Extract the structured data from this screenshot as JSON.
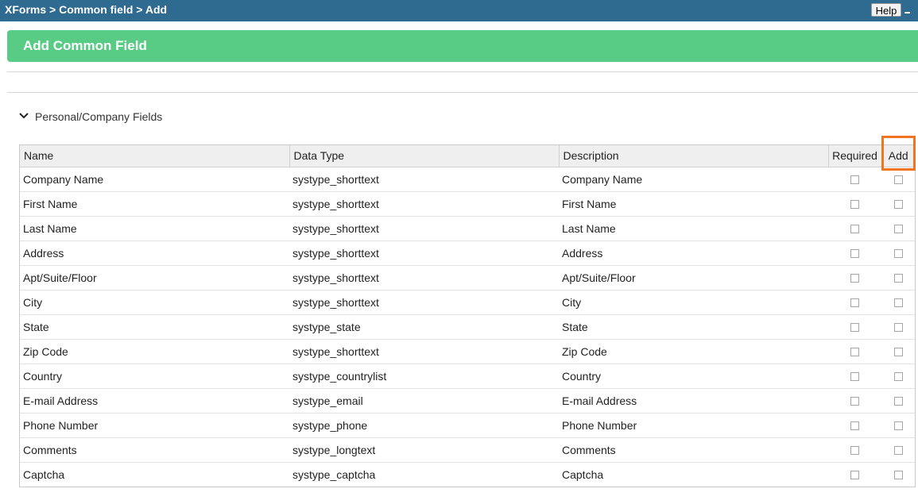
{
  "header": {
    "breadcrumb": "XForms > Common field > Add",
    "help_label": "Help"
  },
  "title": "Add Common Field",
  "section": {
    "label": "Personal/Company Fields"
  },
  "table": {
    "columns": {
      "name": "Name",
      "data_type": "Data Type",
      "description": "Description",
      "required": "Required",
      "add": "Add"
    },
    "rows": [
      {
        "name": "Company Name",
        "data_type": "systype_shorttext",
        "description": "Company Name",
        "required": false,
        "add": false
      },
      {
        "name": "First Name",
        "data_type": "systype_shorttext",
        "description": "First Name",
        "required": false,
        "add": false
      },
      {
        "name": "Last Name",
        "data_type": "systype_shorttext",
        "description": "Last Name",
        "required": false,
        "add": false
      },
      {
        "name": "Address",
        "data_type": "systype_shorttext",
        "description": "Address",
        "required": false,
        "add": false
      },
      {
        "name": "Apt/Suite/Floor",
        "data_type": "systype_shorttext",
        "description": "Apt/Suite/Floor",
        "required": false,
        "add": false
      },
      {
        "name": "City",
        "data_type": "systype_shorttext",
        "description": "City",
        "required": false,
        "add": false
      },
      {
        "name": "State",
        "data_type": "systype_state",
        "description": "State",
        "required": false,
        "add": false
      },
      {
        "name": "Zip Code",
        "data_type": "systype_shorttext",
        "description": "Zip Code",
        "required": false,
        "add": false
      },
      {
        "name": "Country",
        "data_type": "systype_countrylist",
        "description": "Country",
        "required": false,
        "add": false
      },
      {
        "name": "E-mail Address",
        "data_type": "systype_email",
        "description": "E-mail Address",
        "required": false,
        "add": false
      },
      {
        "name": "Phone Number",
        "data_type": "systype_phone",
        "description": "Phone Number",
        "required": false,
        "add": false
      },
      {
        "name": "Comments",
        "data_type": "systype_longtext",
        "description": "Comments",
        "required": false,
        "add": false
      },
      {
        "name": "Captcha",
        "data_type": "systype_captcha",
        "description": "Captcha",
        "required": false,
        "add": false
      }
    ]
  },
  "colors": {
    "header_bg": "#2f6a90",
    "title_bg": "#58cc84",
    "highlight": "#f47321"
  },
  "icons": {
    "section_toggle": "chevron-down-icon",
    "window_control": "minimize-icon"
  }
}
